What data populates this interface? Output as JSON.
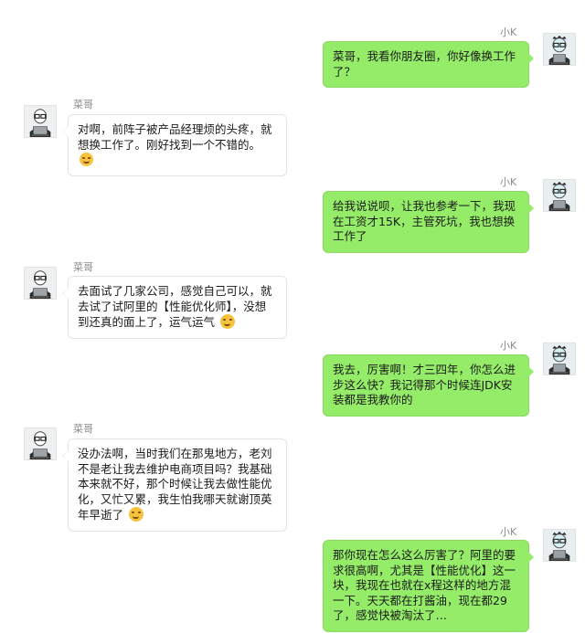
{
  "users": {
    "me": {
      "name": "小K"
    },
    "other": {
      "name": "菜哥"
    }
  },
  "messages": [
    {
      "sender": "me",
      "text": "菜哥，我看你朋友圈，你好像换工作了？"
    },
    {
      "sender": "other",
      "text": "对啊，前阵子被产品经理烦的头疼，就想换工作了。刚好找到一个不错的。",
      "emoji": "smile-emoji-icon"
    },
    {
      "sender": "me",
      "text": "给我说说呗，让我也参考一下，我现在工资才15K，主管死坑，我也想换工作了"
    },
    {
      "sender": "other",
      "text": "去面试了几家公司，感觉自己可以，就去试了试阿里的【性能优化师】，没想到还真的面上了，运气运气",
      "emoji": "laughing-emoji-icon"
    },
    {
      "sender": "me",
      "text": "我去，厉害啊！才三四年，你怎么进步这么快？我记得那个时候连JDK安装都是我教你的"
    },
    {
      "sender": "other",
      "text": "没办法啊，当时我们在那鬼地方，老刘不是老让我去维护电商项目吗？我基础本来就不好，那个时候让我去做性能优化，又忙又累，我生怕我哪天就谢顶英年早逝了",
      "emoji": "sweat-emoji-icon"
    },
    {
      "sender": "me",
      "text": "那你现在怎么这么厉害了？阿里的要求很高啊，尤其是【性能优化】这一块，我现在也就在x程这样的地方混一下。天天都在打酱油，现在都29了，感觉快被淘汰了…"
    }
  ]
}
